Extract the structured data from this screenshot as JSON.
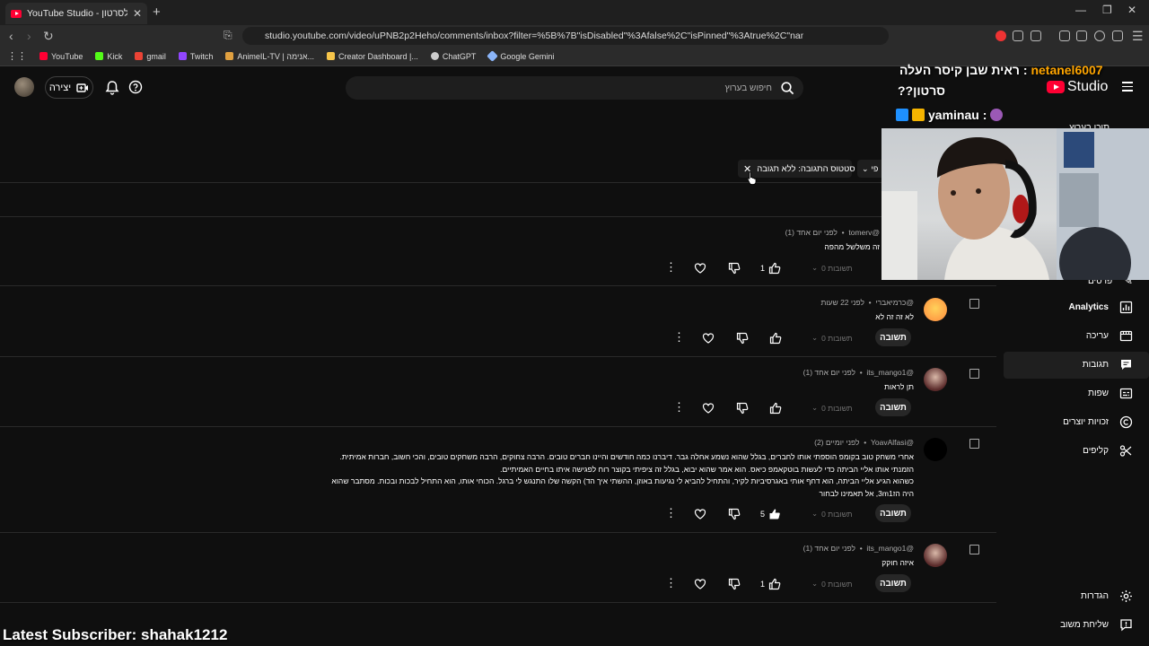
{
  "browser": {
    "tab_title": "YouTube Studio - תגובות לסרטון",
    "url": "studio.youtube.com/video/uPNB2p2Heho/comments/inbox?filter=%5B%7B\"isDisabled\"%3Afalse%2C\"isPinned\"%3Atrue%2C\"name\"%3A\"SORT_BY\"%...",
    "bookmarks": [
      {
        "label": "YouTube",
        "color": "#ff0033"
      },
      {
        "label": "Kick",
        "color": "#53fc18"
      },
      {
        "label": "gmail",
        "color": "#ea4335"
      },
      {
        "label": "Twitch",
        "color": "#9146ff"
      },
      {
        "label": "AnimeIL-TV | אנימה...",
        "color": "#e0a040"
      },
      {
        "label": "Creator Dashboard |...",
        "color": "#f6c54a"
      },
      {
        "label": "ChatGPT",
        "color": "#cccccc"
      },
      {
        "label": "Google Gemini",
        "color": "#8ab4f8"
      }
    ]
  },
  "studio": {
    "create_label": "יצירה",
    "search_placeholder": "חיפוש בערוץ",
    "logo_text": "Studio"
  },
  "stream_overlay": {
    "chat1_user": "netanel6007",
    "chat1_sep": " : ",
    "chat1_msg": "ראית שבן קיסר העלה",
    "chat1_msg2": "??סרטון",
    "chat2_user": "yaminau :",
    "latest_sub": "Latest Subscriber: shahak1212"
  },
  "filter": {
    "chip_label": "סטטוס התגובה: ללא תגובה",
    "more_label": "פי"
  },
  "comments": [
    {
      "author": "@tomerv",
      "time": "לפני יום אחד (1)",
      "text": "זה משלשל מהפה",
      "likes": "1",
      "replies": "0 תשובות",
      "reply_label": "תשובה"
    },
    {
      "author": "@כרמיאברי",
      "time": "לפני 22 שעות",
      "text": "לא זה זה לא",
      "likes": "",
      "replies": "0 תשובות",
      "reply_label": "תשובה"
    },
    {
      "author": "@its_mango1",
      "time": "לפני יום אחד (1)",
      "text": "תן לראות",
      "likes": "",
      "replies": "0 תשובות",
      "reply_label": "תשובה"
    },
    {
      "author": "@YoavAlfasi",
      "time": "לפני יומיים (2)",
      "text_lines": [
        "אחרי משחק טוב בקומפ הוספתי אותו לחברים, בגלל שהוא נשמע אחלה גבר. דיברנו כמה חודשים והיינו חברים טובים. הרבה צחוקים, הרבה משחקים טובים, והכי חשוב, חברות אמיתית.",
        "הזמנתי אותו אליי הביתה כדי לעשות בוטקאמפ כיאס. הוא אמר שהוא יבוא, בגלל זה ציפיתי בקוצר רוח לפגישה איתו בחיים האמיתיים.",
        "כשהוא הגיע אליי הביתה, הוא דחף אותי באגרסיביות לקיר, והתחיל להביא לי נגיעות באוזן, ההשתי איך הד) הקשה שלו התנגש לי ברגל. הכוחי אותו, הוא התחיל לבכות ובכות. מסתבר שהוא",
        "היה הז3m1, אל תאמינו לבחור"
      ],
      "likes": "5",
      "replies": "0 תשובות",
      "reply_label": "תשובה"
    },
    {
      "author": "@its_mango1",
      "time": "לפני יום אחד (1)",
      "text": "איזה חוקק",
      "likes": "1",
      "replies": "0 תשובות",
      "reply_label": "תשובה"
    }
  ],
  "sidebar": {
    "items": [
      {
        "label": "תוכן בערוץ"
      },
      {
        "label": "פרטים"
      },
      {
        "label": "Analytics"
      },
      {
        "label": "עריכה"
      },
      {
        "label": "תגובות"
      },
      {
        "label": "שפות"
      },
      {
        "label": "זכויות יוצרים"
      },
      {
        "label": "קליפים"
      }
    ],
    "settings_label": "הגדרות",
    "feedback_label": "שליחת משוב"
  }
}
